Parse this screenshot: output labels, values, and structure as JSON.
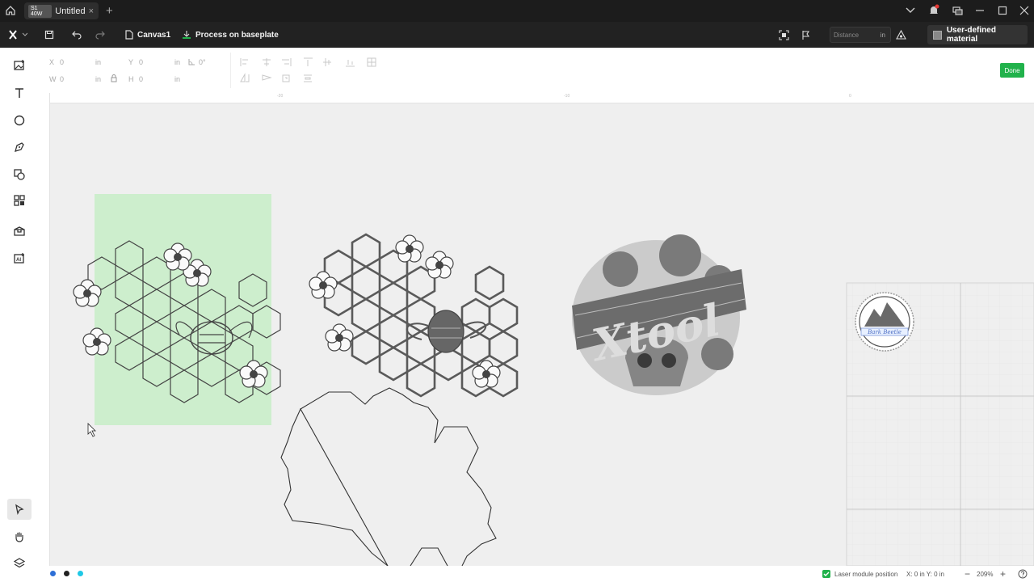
{
  "titlebar": {
    "badge": "S1 40W",
    "tab_title": "Untitled",
    "tab_close": "×",
    "new_tab": "+"
  },
  "toolbar": {
    "canvas_label": "Canvas1",
    "process_label": "Process on baseplate",
    "distance_placeholder": "Distance",
    "distance_unit": "in",
    "material_label": "User-defined material"
  },
  "props": {
    "x_label": "X",
    "x_value": "0",
    "x_unit": "in",
    "y_label": "Y",
    "y_value": "0",
    "y_unit": "in",
    "angle_value": "0°",
    "w_label": "W",
    "w_value": "0",
    "w_unit": "in",
    "h_label": "H",
    "h_value": "0",
    "h_unit": "in",
    "done_label": "Done"
  },
  "ruler": {
    "marks": [
      "-20",
      "-10",
      "0"
    ]
  },
  "canvas": {
    "logo_text": "Xtool",
    "badge_text": "Bark Beetle"
  },
  "status": {
    "laser_label": "Laser module position",
    "coords": "X: 0 in  Y: 0 in",
    "zoom": "209%",
    "zoom_minus": "−",
    "zoom_plus": "+"
  },
  "colors": {
    "accent_green": "#21b24b",
    "selection_fill": "#cdeecd",
    "dot_blue": "#2d6fd6",
    "dot_black": "#222222",
    "dot_cyan": "#1fc8e6"
  }
}
